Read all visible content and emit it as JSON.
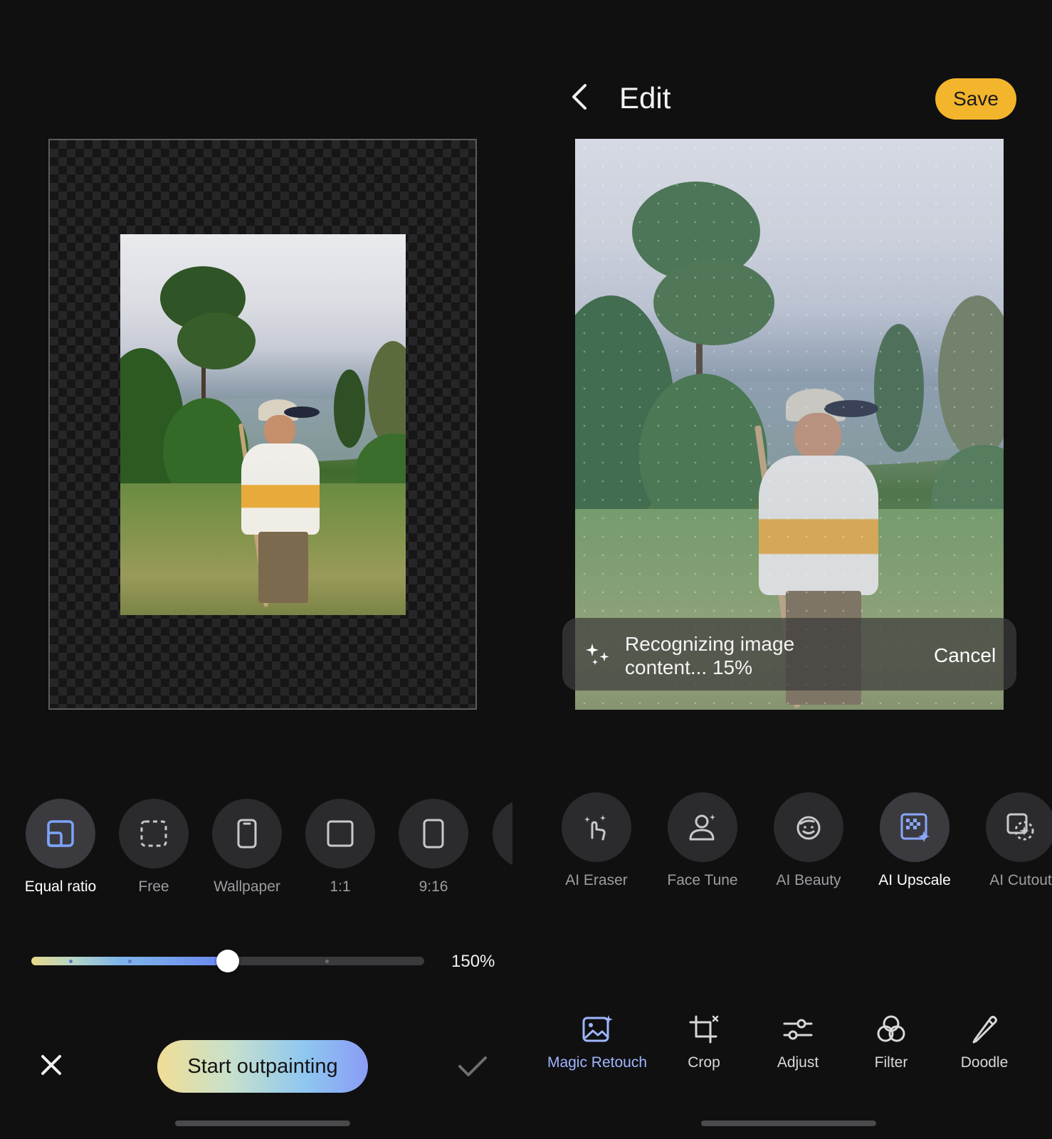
{
  "outpaint": {
    "ratio_options": [
      {
        "label": "Equal ratio",
        "icon": "equal-ratio-icon",
        "active": true
      },
      {
        "label": "Free",
        "icon": "free-crop-icon",
        "active": false
      },
      {
        "label": "Wallpaper",
        "icon": "phone-icon",
        "active": false
      },
      {
        "label": "1:1",
        "icon": "square-icon",
        "active": false
      },
      {
        "label": "9:16",
        "icon": "portrait-icon",
        "active": false
      }
    ],
    "zoom_percent": 150,
    "zoom_label": "150%",
    "start_label": "Start outpainting"
  },
  "editor": {
    "title": "Edit",
    "save_label": "Save",
    "progress_line1": "Recognizing image",
    "progress_line2": "content... 15%",
    "progress_percent": 15,
    "cancel_label": "Cancel",
    "ai_tools": [
      {
        "label": "AI Eraser",
        "icon": "ai-eraser-icon",
        "active": false
      },
      {
        "label": "Face Tune",
        "icon": "face-tune-icon",
        "active": false
      },
      {
        "label": "AI Beauty",
        "icon": "ai-beauty-icon",
        "active": false
      },
      {
        "label": "AI Upscale",
        "icon": "ai-upscale-icon",
        "active": true
      },
      {
        "label": "AI Cutout",
        "icon": "ai-cutout-icon",
        "active": false
      }
    ],
    "bottom_nav": [
      {
        "label": "Magic Retouch",
        "icon": "magic-retouch-icon",
        "active": true
      },
      {
        "label": "Crop",
        "icon": "crop-icon",
        "active": false
      },
      {
        "label": "Adjust",
        "icon": "adjust-icon",
        "active": false
      },
      {
        "label": "Filter",
        "icon": "filter-icon",
        "active": false
      },
      {
        "label": "Doodle",
        "icon": "doodle-icon",
        "active": false
      }
    ]
  },
  "colors": {
    "background": "#101011",
    "save": "#f3b52b",
    "active_nav": "#9fb6ff"
  }
}
